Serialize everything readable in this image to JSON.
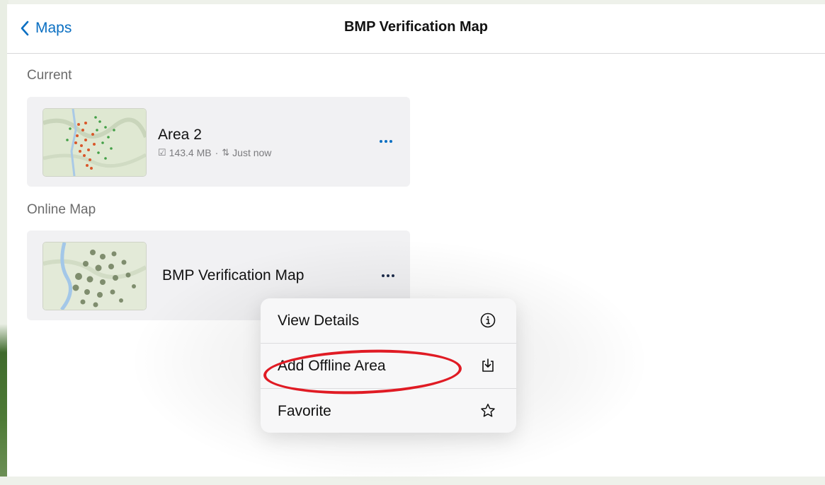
{
  "nav": {
    "back_label": "Maps",
    "title": "BMP Verification Map"
  },
  "sections": {
    "current_label": "Current",
    "online_label": "Online Map"
  },
  "current_area": {
    "name": "Area 2",
    "size": "143.4 MB",
    "separator": "·",
    "sync_status": "Just now"
  },
  "online_map": {
    "name": "BMP Verification Map"
  },
  "context_menu": {
    "items": [
      {
        "label": "View Details",
        "icon": "info-circle-icon"
      },
      {
        "label": "Add Offline Area",
        "icon": "download-tray-icon"
      },
      {
        "label": "Favorite",
        "icon": "star-outline-icon"
      }
    ]
  },
  "colors": {
    "accent": "#0a6fc2",
    "highlight_ring": "#e01b24",
    "more_dots_current": "#0a6fc2",
    "more_dots_online": "#1c2b4a"
  }
}
